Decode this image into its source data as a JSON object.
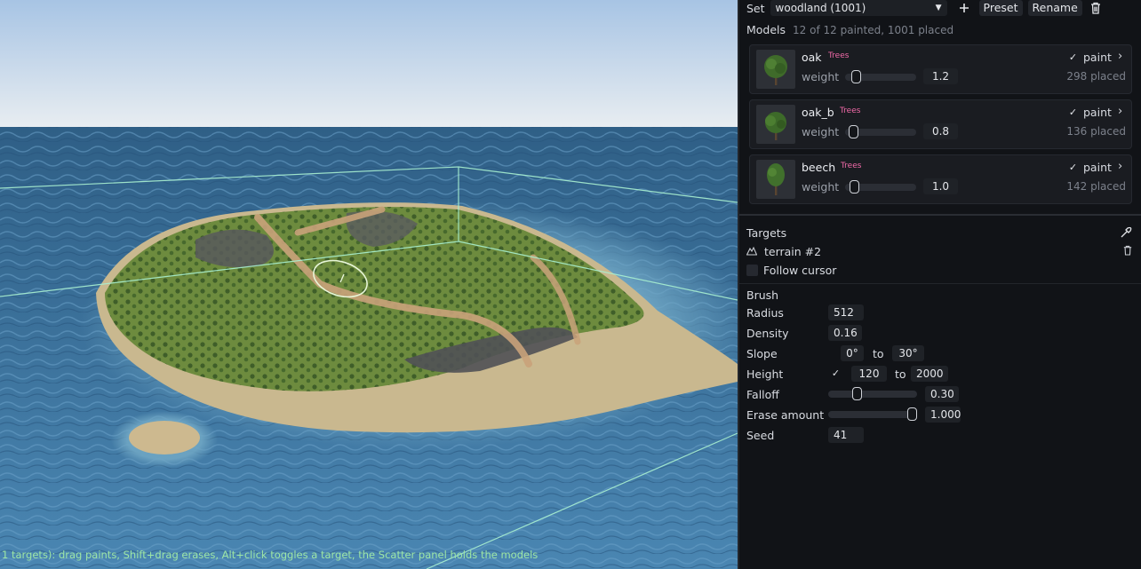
{
  "viewport": {
    "status_text": "1 targets): drag paints, Shift+drag erases, Alt+click toggles a target, the Scatter panel holds the models",
    "colors": {
      "sky_top": "#a9c6e6",
      "sky_horizon": "#e9eef2",
      "ocean": "#3f7aa8",
      "grass": "#6d8b3e",
      "sand": "#c9b88f",
      "rock": "#55575c",
      "bounds_line": "#a8f0d0"
    }
  },
  "set": {
    "label": "Set",
    "selected": "woodland (1001)",
    "add_icon": "plus-icon",
    "preset_label": "Preset",
    "rename_label": "Rename",
    "delete_icon": "trash-icon"
  },
  "models": {
    "title": "Models",
    "summary": "12 of 12 painted, 1001 placed",
    "items": [
      {
        "name": "oak",
        "tag": "Trees",
        "weight_label": "weight",
        "weight": "1.2",
        "weight_fraction": 0.12,
        "paint_checked": true,
        "paint_label": "paint",
        "placed": "298 placed"
      },
      {
        "name": "oak_b",
        "tag": "Trees",
        "weight_label": "weight",
        "weight": "0.8",
        "weight_fraction": 0.08,
        "paint_checked": true,
        "paint_label": "paint",
        "placed": "136 placed"
      },
      {
        "name": "beech",
        "tag": "Trees",
        "weight_label": "weight",
        "weight": "1.0",
        "weight_fraction": 0.1,
        "paint_checked": true,
        "paint_label": "paint",
        "placed": "142 placed"
      }
    ]
  },
  "targets": {
    "title": "Targets",
    "picker_icon": "eyedropper-icon",
    "items": [
      {
        "icon": "terrain-icon",
        "name": "terrain #2",
        "remove_icon": "trash-icon"
      }
    ],
    "follow_cursor_label": "Follow cursor",
    "follow_cursor_checked": false
  },
  "brush": {
    "title": "Brush",
    "radius_label": "Radius",
    "radius": "512 u",
    "density_label": "Density",
    "density": "0.16",
    "slope_label": "Slope",
    "slope_min": "0°",
    "slope_to": "to",
    "slope_max": "30°",
    "height_label": "Height",
    "height_enabled": true,
    "height_min": "120",
    "height_to": "to",
    "height_max": "2000",
    "falloff_label": "Falloff",
    "falloff": "0.30",
    "falloff_fraction": 0.3,
    "erase_label": "Erase amount",
    "erase": "1.000",
    "erase_fraction": 1.0,
    "seed_label": "Seed",
    "seed": "41"
  }
}
